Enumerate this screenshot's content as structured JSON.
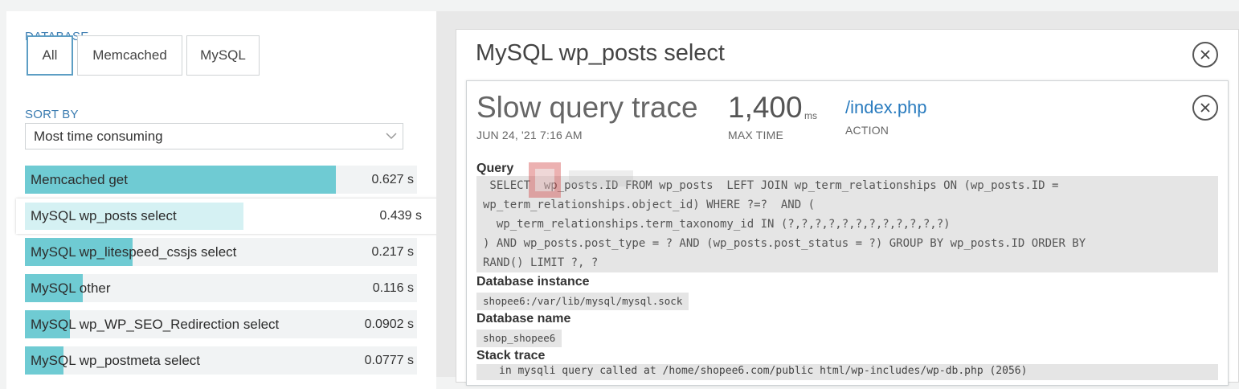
{
  "filters": {
    "database_label": "DATABASE",
    "database_options": [
      "All",
      "Memcached",
      "MySQL"
    ],
    "sort_label": "SORT BY",
    "sort_value": "Most time consuming"
  },
  "queries": [
    {
      "name": "Memcached get",
      "value": "0.627 s",
      "fraction": 1.0
    },
    {
      "name": "MySQL wp_posts select",
      "value": "0.439 s",
      "fraction": 0.7
    },
    {
      "name": "MySQL wp_litespeed_cssjs select",
      "value": "0.217 s",
      "fraction": 0.346
    },
    {
      "name": "MySQL other",
      "value": "0.116 s",
      "fraction": 0.185
    },
    {
      "name": "MySQL wp_WP_SEO_Redirection select",
      "value": "0.0902 s",
      "fraction": 0.144
    },
    {
      "name": "MySQL wp_postmeta select",
      "value": "0.0777 s",
      "fraction": 0.124
    }
  ],
  "detail": {
    "title": "MySQL wp_posts select",
    "trace_title": "Slow query trace",
    "timestamp": "JUN 24, '21 7:16 AM",
    "max_time_value": "1,400",
    "max_time_unit": "ms",
    "max_time_label": "MAX TIME",
    "action_value": "/index.php",
    "action_label": "ACTION",
    "query_label": "Query",
    "query_text": " SELECT  wp_posts.ID FROM wp_posts  LEFT JOIN wp_term_relationships ON (wp_posts.ID =\nwp_term_relationships.object_id) WHERE ?=?  AND (\n  wp_term_relationships.term_taxonomy_id IN (?,?,?,?,?,?,?,?,?,?,?,?)\n) AND wp_posts.post_type = ? AND (wp_posts.post_status = ?) GROUP BY wp_posts.ID ORDER BY\nRAND() LIMIT ?, ?",
    "db_instance_label": "Database instance",
    "db_instance_value": "shopee6:/var/lib/mysql/mysql.sock",
    "db_name_label": "Database name",
    "db_name_value": "shop_shopee6",
    "stack_label": "Stack trace",
    "stack_text": "in mysqli query called at /home/shopee6.com/public html/wp-includes/wp-db.php (2056)"
  },
  "colors": {
    "bar": "#6fcbd3",
    "bar_selected": "#d5f1f3",
    "link": "#2a7cbf",
    "accent": "#3a7bb0"
  }
}
